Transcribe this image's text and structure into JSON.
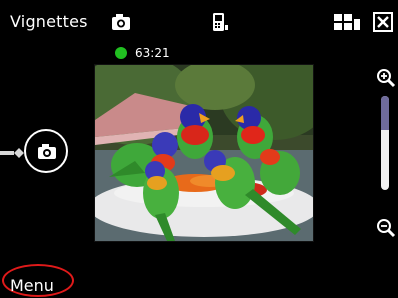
{
  "header": {
    "title": "Vignettes",
    "icons": [
      "camera-icon",
      "phone-icon",
      "tile-view-icon",
      "close-icon"
    ]
  },
  "status": {
    "timer": "63:21",
    "indicator_color": "#21c021"
  },
  "photo": {
    "subject": "parrots-photo"
  },
  "zoom": {
    "in_icon": "zoom-in-icon",
    "out_icon": "zoom-out-icon",
    "level": 0.36
  },
  "capture": {
    "icon": "camera-icon"
  },
  "softkey": {
    "menu_label": "Menu",
    "highlight_color": "#e01a1a"
  }
}
